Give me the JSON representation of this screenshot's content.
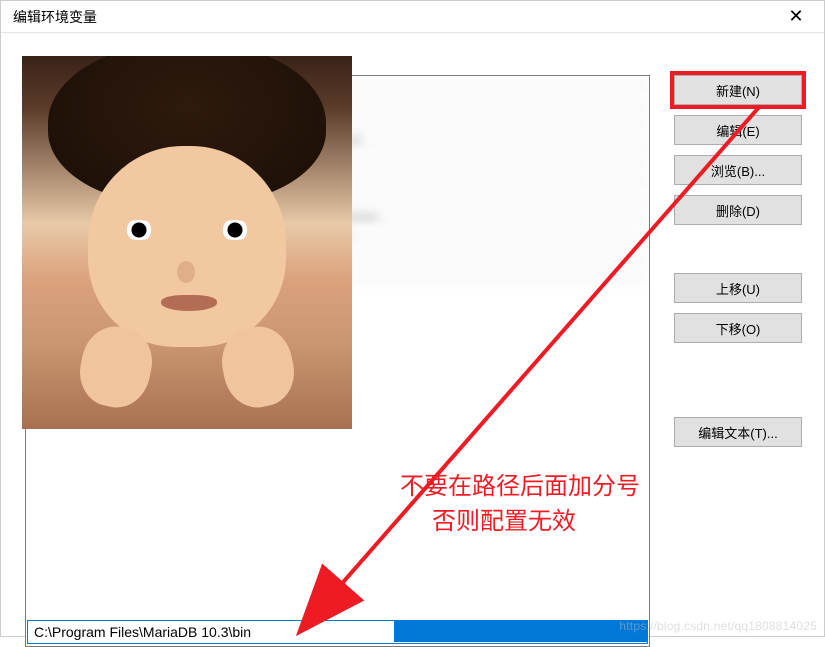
{
  "window": {
    "title": "编辑环境变量",
    "close": "✕"
  },
  "buttons": {
    "new": "新建(N)",
    "edit": "编辑(E)",
    "browse": "浏览(B)...",
    "delete": "删除(D)",
    "moveUp": "上移(U)",
    "moveDown": "下移(O)",
    "editText": "编辑文本(T)..."
  },
  "list": {
    "rows": [
      "%SystemRoot%\\system32",
      "%SystemRoot%",
      "%SystemRoot%\\System32\\Wbem",
      "%SYSTEMROOT%\\System32\\WindowsPowerShell\\v1.0\\",
      "%SYSTEMROOT%\\System32\\OpenSSH\\",
      "C:\\Program Files\\Git\\cmd",
      "C:\\Program Files\\nodejs\\",
      "C:\\Program Files (x86)\\NVIDIA Corporation\\PhysX\\Common",
      "C:\\Program Files\\Microsoft SQL Server\\130\\Tools\\Binn\\",
      "C:\\Program Files\\Java\\jdk1.8.0_201\\bin",
      "C:\\Program Files\\...\\bin"
    ],
    "editing": "C:\\Program Files\\MariaDB 10.3\\bin"
  },
  "annotation": {
    "line1": "不要在路径后面加分号",
    "line2": "否则配置无效"
  },
  "watermark": "https://blog.csdn.net/qq1808814025"
}
